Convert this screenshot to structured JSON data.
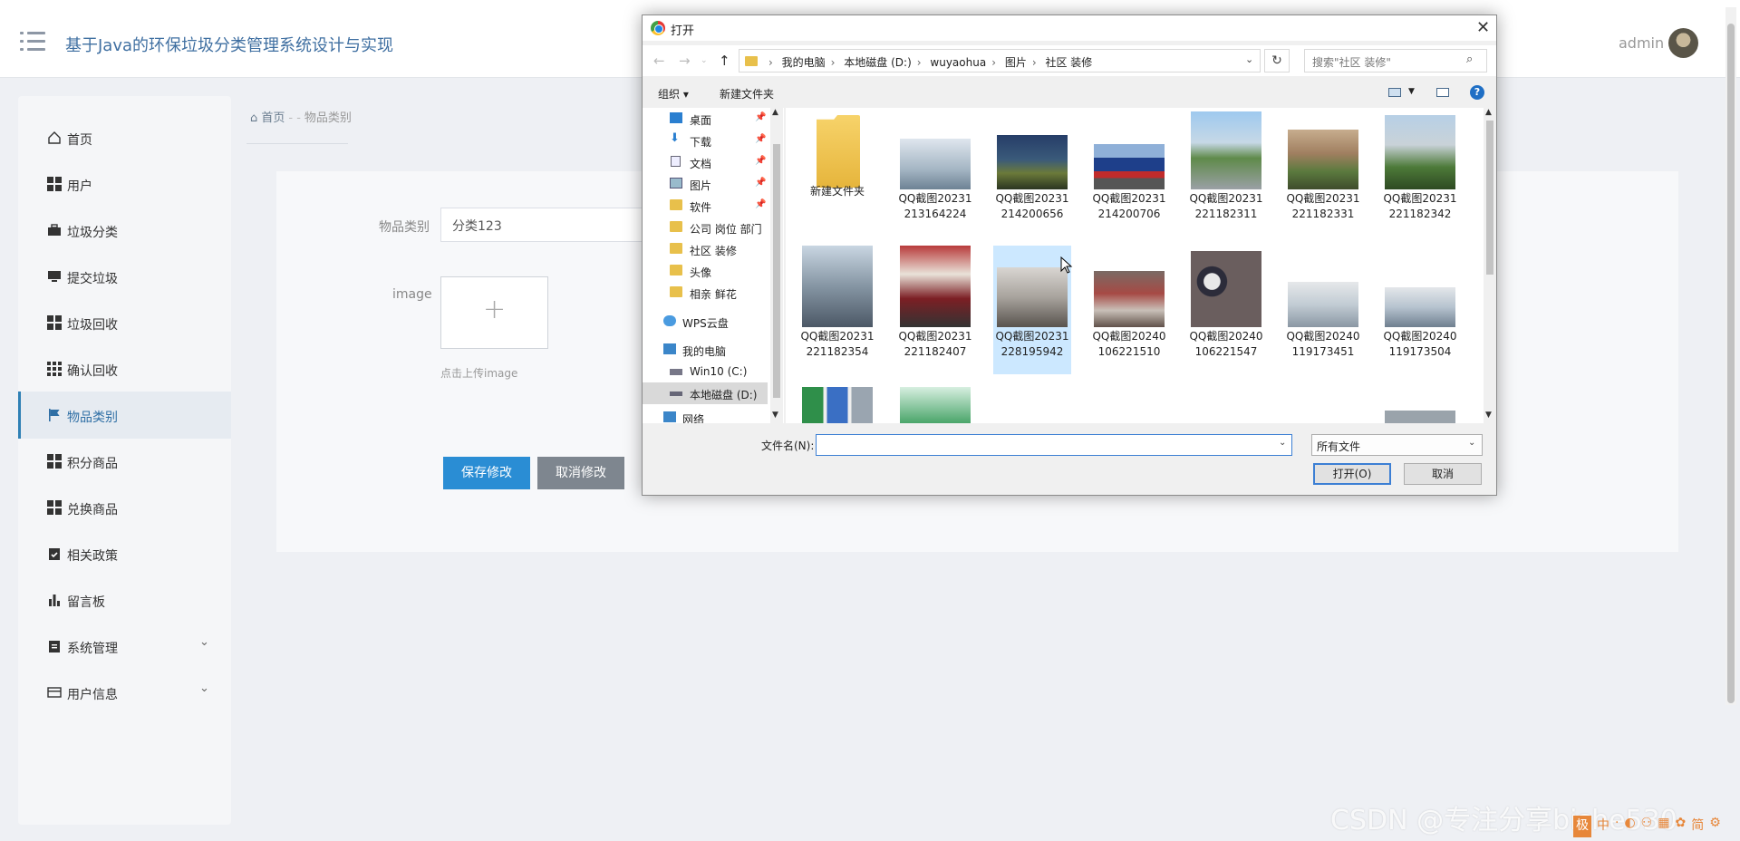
{
  "header": {
    "app_title": "基于Java的环保垃圾分类管理系统设计与实现",
    "username": "admin"
  },
  "sidebar": {
    "items": [
      {
        "label": "首页",
        "icon": "home-icon"
      },
      {
        "label": "用户",
        "icon": "grid-icon"
      },
      {
        "label": "垃圾分类",
        "icon": "briefcase-icon"
      },
      {
        "label": "提交垃圾",
        "icon": "monitor-icon"
      },
      {
        "label": "垃圾回收",
        "icon": "grid-icon"
      },
      {
        "label": "确认回收",
        "icon": "grid-9-icon"
      },
      {
        "label": "物品类别",
        "icon": "flag-icon",
        "active": true
      },
      {
        "label": "积分商品",
        "icon": "grid-icon"
      },
      {
        "label": "兑换商品",
        "icon": "grid-icon"
      },
      {
        "label": "相关政策",
        "icon": "clipboard-check-icon"
      },
      {
        "label": "留言板",
        "icon": "bar-chart-icon"
      },
      {
        "label": "系统管理",
        "icon": "clipboard-icon"
      },
      {
        "label": "用户信息",
        "icon": "card-icon"
      }
    ]
  },
  "breadcrumb": {
    "home": "首页",
    "separator": "- -",
    "current": "物品类别"
  },
  "form": {
    "category_label": "物品类别",
    "category_value": "分类123",
    "image_label": "image",
    "upload_hint": "点击上传image",
    "save_label": "保存修改",
    "cancel_label": "取消修改"
  },
  "dialog": {
    "title": "打开",
    "path": [
      "我的电脑",
      "本地磁盘 (D:)",
      "wuyaohua",
      "图片",
      "社区  装修"
    ],
    "search_placeholder": "搜索\"社区  装修\"",
    "organize": "组织 ▾",
    "new_folder": "新建文件夹",
    "tree": [
      {
        "label": "桌面",
        "pinned": true
      },
      {
        "label": "下载",
        "pinned": true
      },
      {
        "label": "文档",
        "pinned": true
      },
      {
        "label": "图片",
        "pinned": true
      },
      {
        "label": "软件",
        "pinned": true
      },
      {
        "label": "公司 岗位 部门"
      },
      {
        "label": "社区  装修"
      },
      {
        "label": "头像"
      },
      {
        "label": "相亲  鲜花"
      },
      {
        "label": "WPS云盘"
      },
      {
        "label": "我的电脑"
      },
      {
        "label": "Win10 (C:)"
      },
      {
        "label": "本地磁盘 (D:)"
      },
      {
        "label": "网络"
      }
    ],
    "files": [
      {
        "name": "新建文件夹"
      },
      {
        "name": "QQ截图20231213164224"
      },
      {
        "name": "QQ截图20231214200656"
      },
      {
        "name": "QQ截图20231214200706"
      },
      {
        "name": "QQ截图20231221182311"
      },
      {
        "name": "QQ截图20231221182331"
      },
      {
        "name": "QQ截图20231221182342"
      },
      {
        "name": "QQ截图20231221182354"
      },
      {
        "name": "QQ截图20231221182407"
      },
      {
        "name": "QQ截图20231228195942"
      },
      {
        "name": "QQ截图20240106221510"
      },
      {
        "name": "QQ截图20240106221547"
      },
      {
        "name": "QQ截图20240119173451"
      },
      {
        "name": "QQ截图20240119173504"
      }
    ],
    "filename_label": "文件名(N):",
    "filename_value": "",
    "filetype": "所有文件",
    "open_label": "打开(O)",
    "cancel_label": "取消"
  },
  "watermark": "CSDN @专注分享bishe530",
  "ime": [
    "极",
    "中",
    "·",
    "◐",
    "⚇",
    "▦",
    "✿",
    "简",
    "⚙"
  ],
  "colors": {
    "accent": "#2a8dd4",
    "title": "#3f6fa1",
    "active_nav": "#e6ebf1"
  }
}
